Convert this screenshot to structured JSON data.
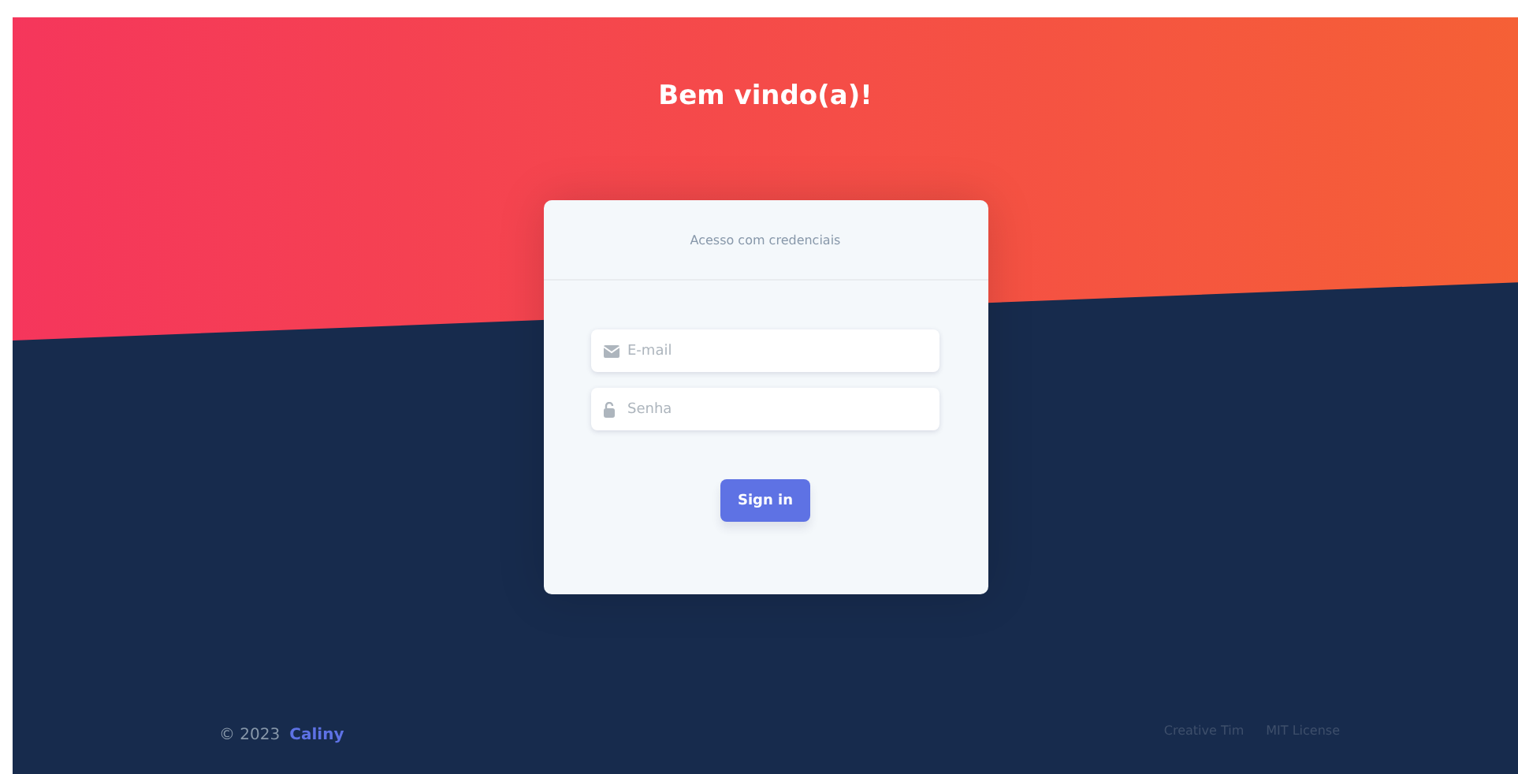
{
  "header": {
    "title": "Bem vindo(a)!"
  },
  "login_card": {
    "heading": "Acesso com credenciais",
    "fields": [
      {
        "kind": "email",
        "placeholder": "E-mail"
      },
      {
        "kind": "password",
        "placeholder": "Senha"
      }
    ],
    "button": "Sign in"
  },
  "footer": {
    "copyright": "© 2023",
    "brand": "Caliny",
    "links": [
      "Creative Tim",
      "MIT License"
    ]
  }
}
